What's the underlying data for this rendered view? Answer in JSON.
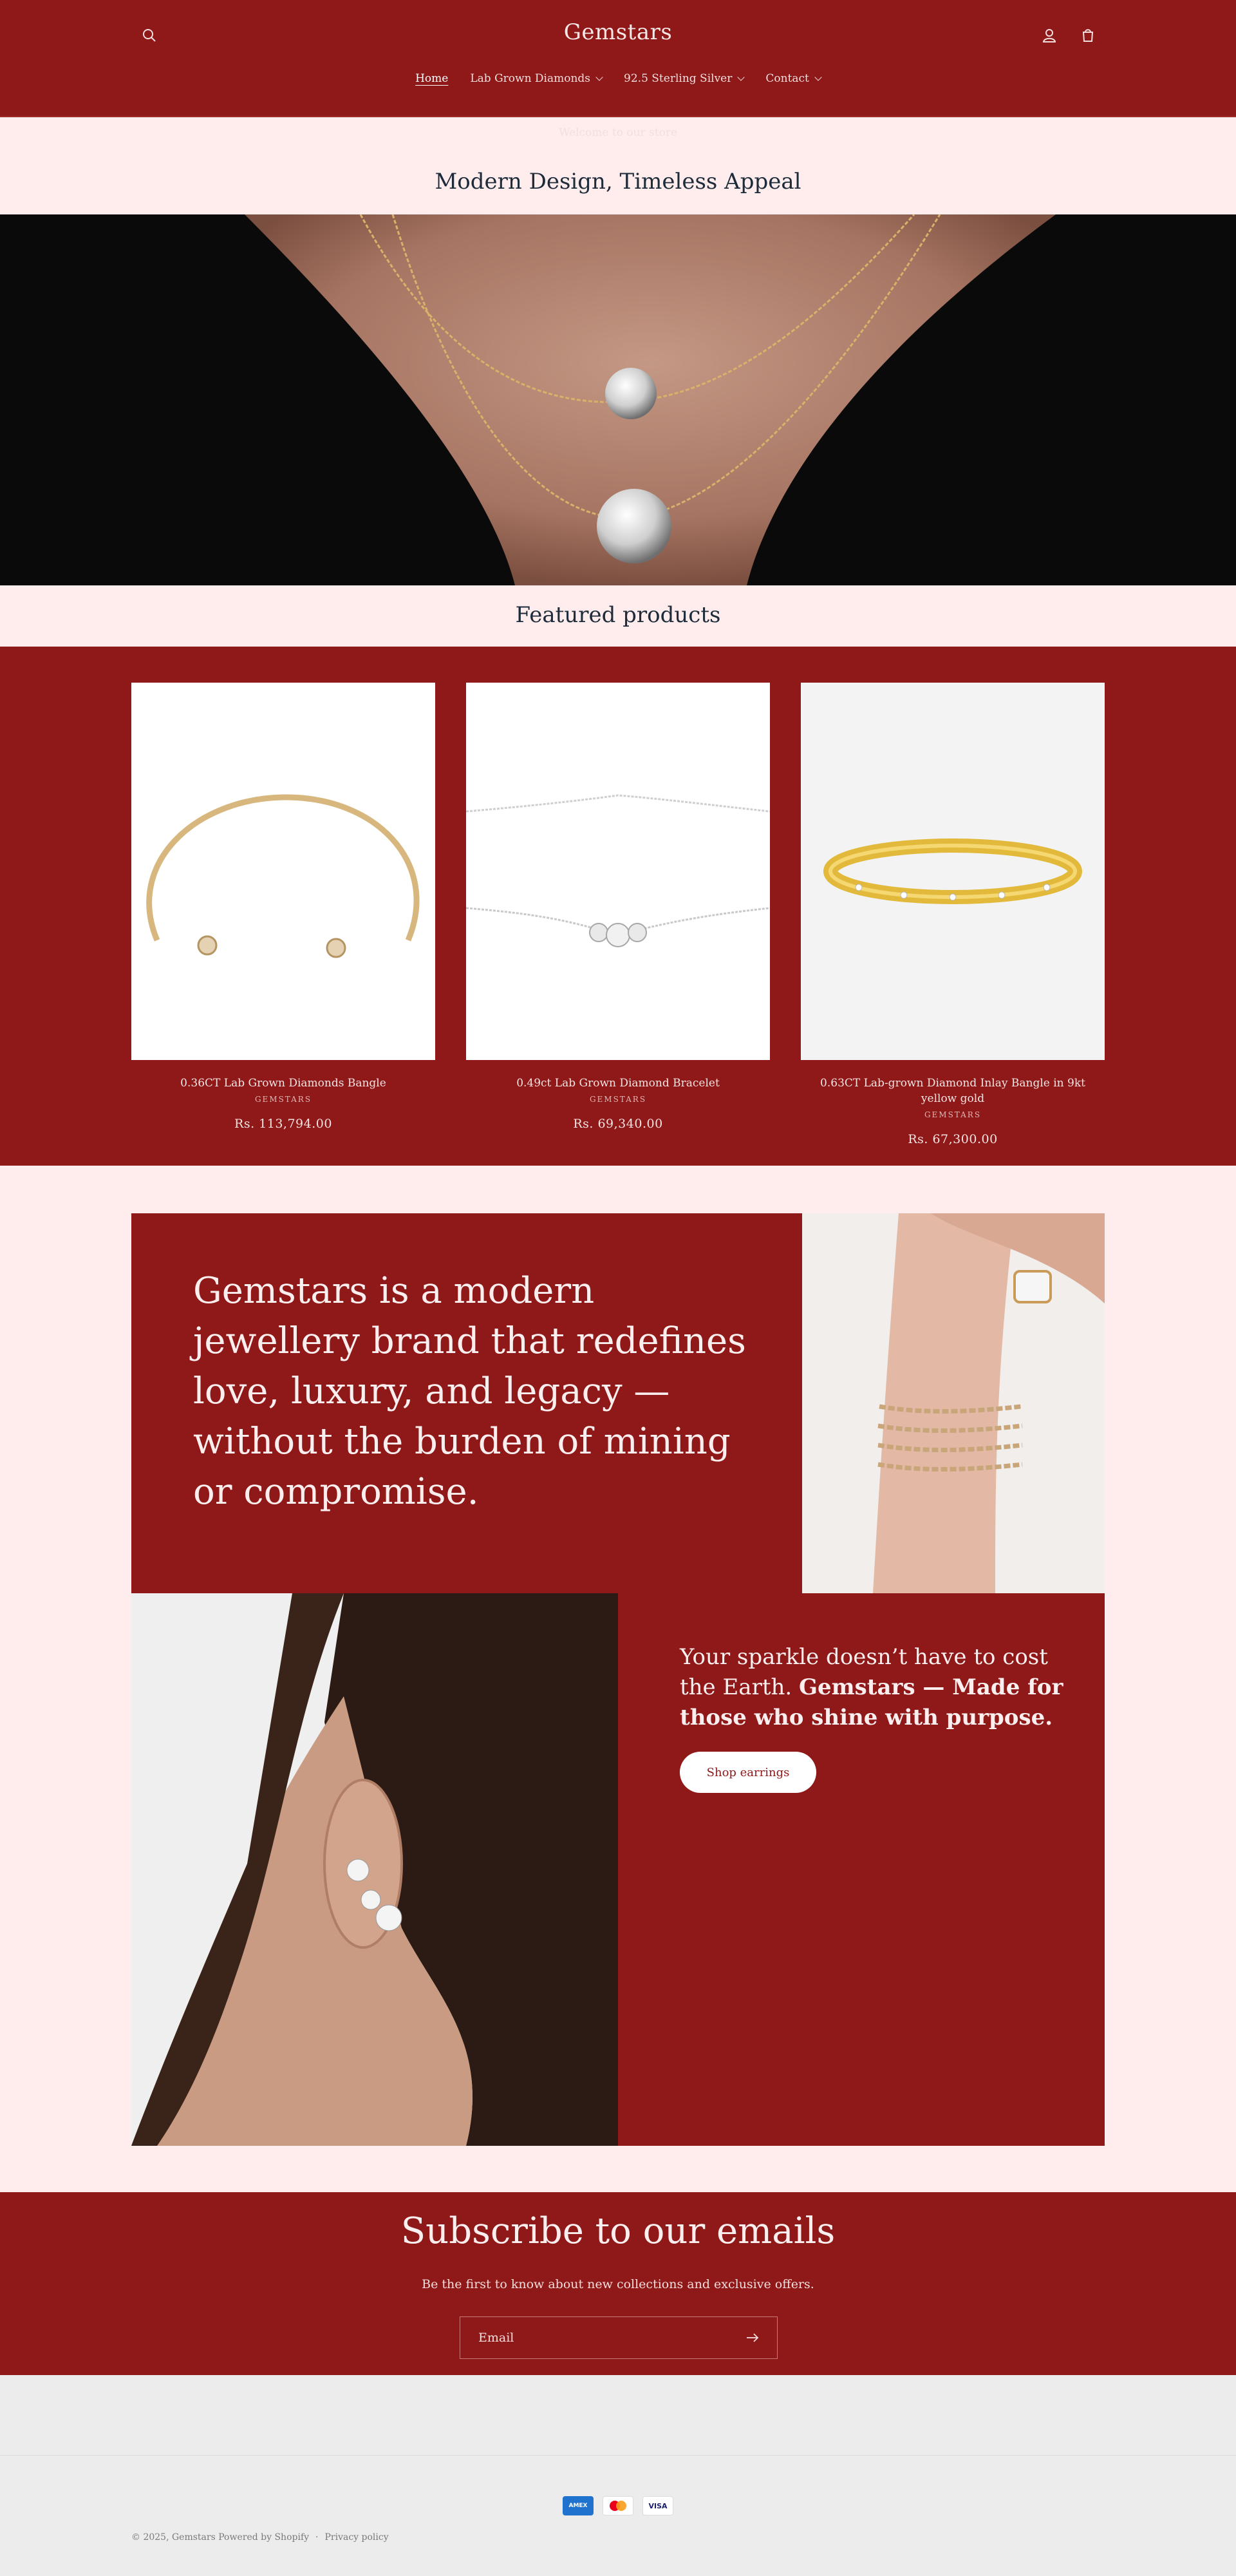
{
  "header": {
    "logo": "Gemstars",
    "nav": [
      {
        "label": "Home",
        "active": true,
        "has_dropdown": false
      },
      {
        "label": "Lab Grown Diamonds",
        "active": false,
        "has_dropdown": true
      },
      {
        "label": "92.5 Sterling Silver",
        "active": false,
        "has_dropdown": true
      },
      {
        "label": "Contact",
        "active": false,
        "has_dropdown": true
      }
    ],
    "announcement": "Welcome to our store",
    "icons": [
      "search-icon",
      "account-icon",
      "cart-icon"
    ]
  },
  "hero": {
    "title": "Modern Design, Timeless Appeal"
  },
  "featured": {
    "title": "Featured products",
    "products": [
      {
        "title": "0.36CT Lab Grown Diamonds Bangle",
        "vendor": "GEMSTARS",
        "price": "Rs. 113,794.00"
      },
      {
        "title": "0.49ct Lab Grown Diamond Bracelet",
        "vendor": "GEMSTARS",
        "price": "Rs. 69,340.00"
      },
      {
        "title": "0.63CT Lab-grown Diamond Inlay Bangle in 9kt yellow gold",
        "vendor": "GEMSTARS",
        "price": "Rs. 67,300.00"
      }
    ]
  },
  "story": {
    "heading": "Gemstars is a modern jewellery brand that redefines love, luxury, and legacy — without the burden of mining or compromise.",
    "sub_plain": "Your sparkle doesn’t have to cost the Earth.",
    "sub_bold": "Gemstars — Made for those who shine with purpose.",
    "button": "Shop earrings"
  },
  "newsletter": {
    "title": "Subscribe to our emails",
    "text": "Be the first to know about new collections and exclusive offers.",
    "placeholder": "Email"
  },
  "footer": {
    "payments": [
      "AMEX",
      "Mastercard",
      "VISA"
    ],
    "copyright": "© 2025, Gemstars Powered by Shopify",
    "separator": "·",
    "policy": "Privacy policy"
  },
  "colors": {
    "brand_red": "#8f1818",
    "blush": "#ffecec",
    "footer_gray": "#ececec"
  }
}
